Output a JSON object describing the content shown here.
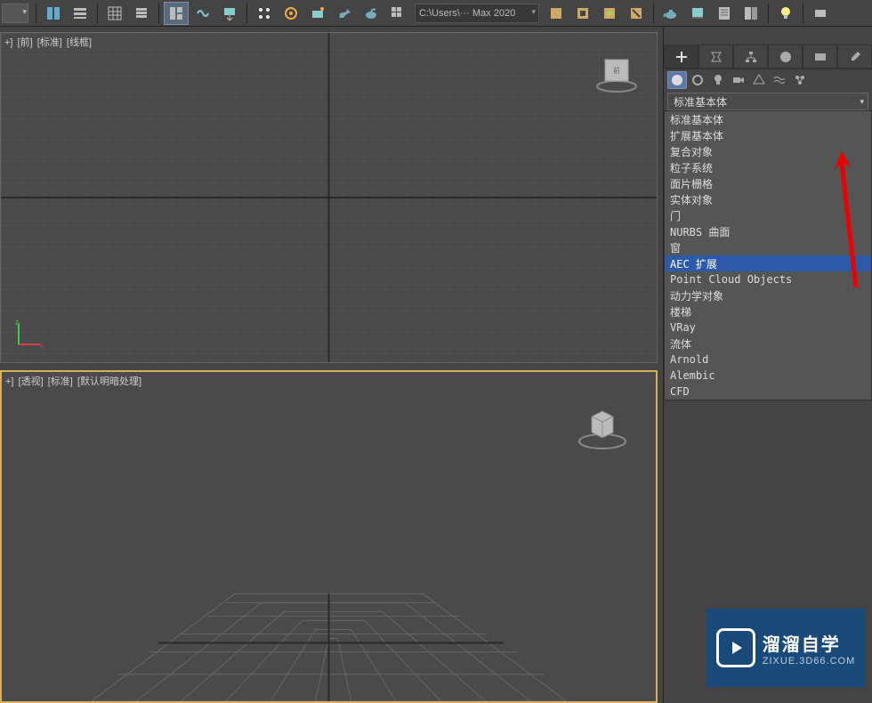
{
  "toolbar": {
    "path": "C:\\Users\\··· Max 2020"
  },
  "viewports": {
    "top": {
      "plus": "+]",
      "view": "[前]",
      "shade": "[标准]",
      "mode": "[线框]"
    },
    "bottom": {
      "plus": "+]",
      "view": "[透视]",
      "shade": "[标准]",
      "mode": "[默认明暗处理]"
    }
  },
  "panel": {
    "combo_selected": "标准基本体",
    "items": [
      "标准基本体",
      "扩展基本体",
      "复合对象",
      "粒子系统",
      "面片栅格",
      "实体对象",
      "门",
      "NURBS 曲面",
      "窗",
      "AEC 扩展",
      "Point Cloud Objects",
      "动力学对象",
      "楼梯",
      "VRay",
      "流体",
      "Arnold",
      "Alembic",
      "CFD"
    ],
    "selected_index": 9
  },
  "watermark": {
    "main": "溜溜自学",
    "sub": "ZIXUE.3D66.COM"
  }
}
